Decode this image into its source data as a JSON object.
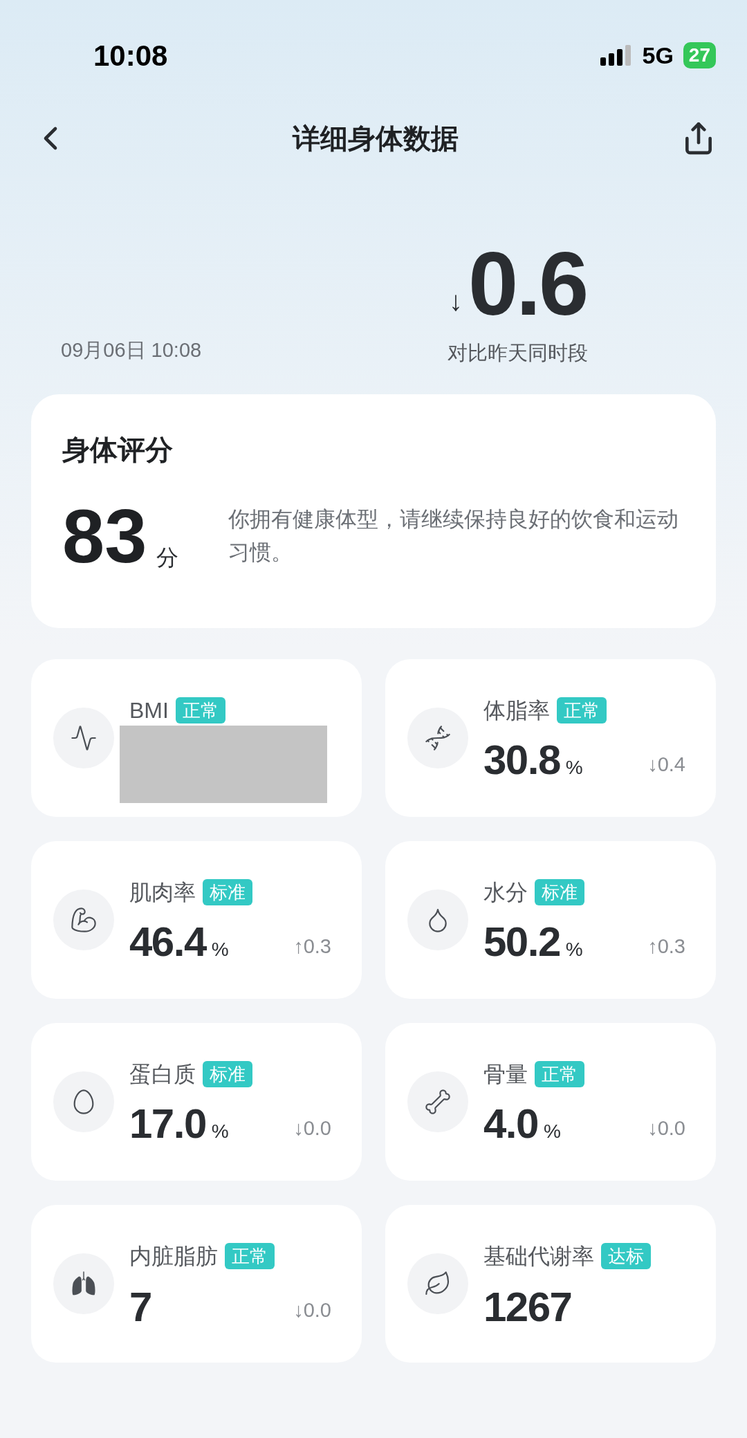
{
  "status_bar": {
    "time": "10:08",
    "network": "5G",
    "battery": "27"
  },
  "header": {
    "title": "详细身体数据"
  },
  "comparison": {
    "arrow": "↓",
    "value": "0.6",
    "caption": "对比昨天同时段",
    "date": "09月06日 10:08"
  },
  "score_card": {
    "title": "身体评分",
    "score": "83",
    "unit": "分",
    "description": "你拥有健康体型，请继续保持良好的饮食和运动习惯。"
  },
  "metrics": [
    {
      "kind": "pulse",
      "name": "BMI",
      "badge": "正常",
      "redacted": true
    },
    {
      "kind": "dna",
      "name": "体脂率",
      "badge": "正常",
      "value": "30.8",
      "unit": "%",
      "change": "↓0.4"
    },
    {
      "kind": "muscle",
      "name": "肌肉率",
      "badge": "标准",
      "value": "46.4",
      "unit": "%",
      "change": "↑0.3"
    },
    {
      "kind": "water",
      "name": "水分",
      "badge": "标准",
      "value": "50.2",
      "unit": "%",
      "change": "↑0.3"
    },
    {
      "kind": "egg",
      "name": "蛋白质",
      "badge": "标准",
      "value": "17.0",
      "unit": "%",
      "change": "↓0.0"
    },
    {
      "kind": "bone",
      "name": "骨量",
      "badge": "正常",
      "value": "4.0",
      "unit": "%",
      "change": "↓0.0"
    },
    {
      "kind": "lungs",
      "name": "内脏脂肪",
      "badge": "正常",
      "value": "7",
      "change": "↓0.0"
    },
    {
      "kind": "leaf",
      "name": "基础代谢率",
      "badge": "达标",
      "value": "1267"
    }
  ]
}
